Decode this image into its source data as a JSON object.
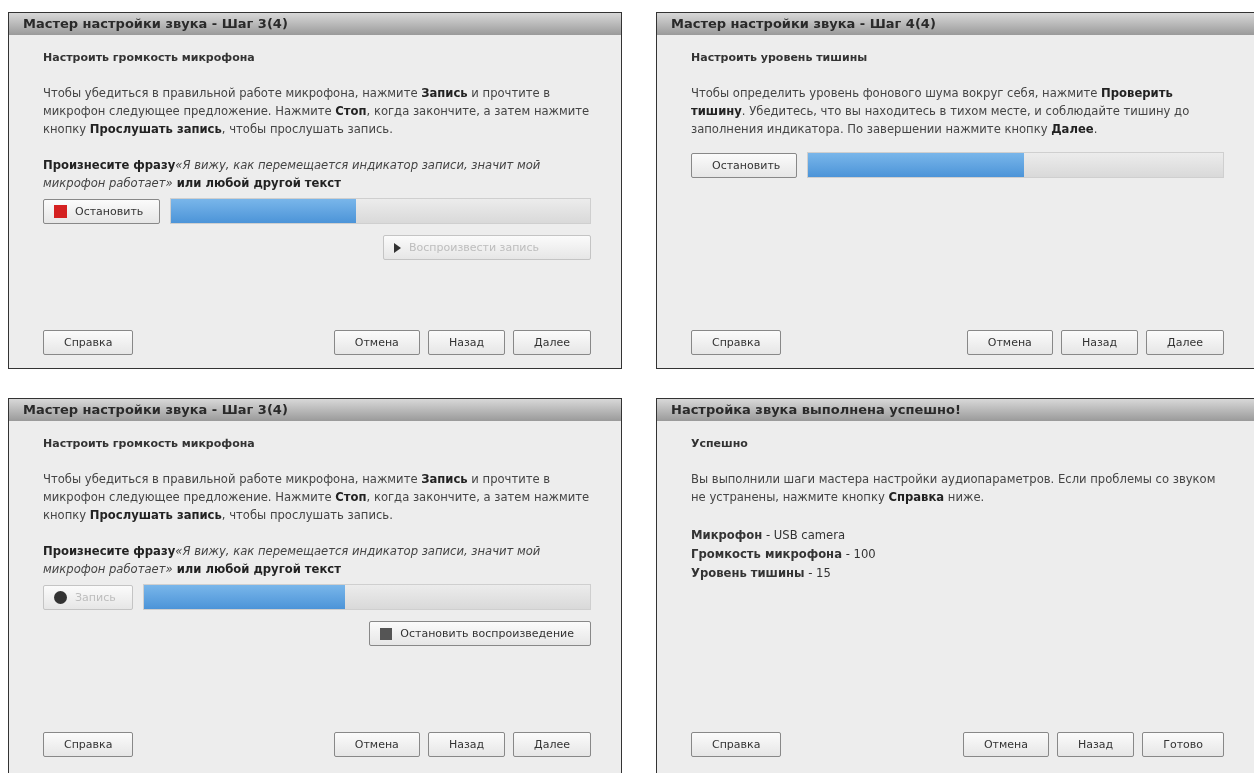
{
  "windows": [
    {
      "title": "Мастер настройки звука - Шаг 3(4)",
      "heading": "Настроить громкость микрофона",
      "paragraphs": [
        "Чтобы убедиться в правильной работе микрофона, нажмите **Запись** и прочтите в микрофон следующее предложение. Нажмите **Стоп**, когда закончите, а затем нажмите кнопку **Прослушать запись**, чтобы прослушать запись."
      ],
      "phrase": {
        "lead": "Произнесите фразу",
        "quote": "«Я вижу, как перемещается индикатор записи, значит мой микрофон работает»",
        "tail": " или любой другой текст"
      },
      "action": {
        "label": "Остановить",
        "kind": "stop",
        "disabled": false
      },
      "level": 0.44,
      "secondary": {
        "label": "Воспроизвести запись",
        "kind": "play",
        "disabled": true
      },
      "buttons": [
        "Справка",
        "Отмена",
        "Назад",
        "Далее"
      ]
    },
    {
      "title": "Мастер настройки звука - Шаг 4(4)",
      "heading": "Настроить уровень тишины",
      "paragraphs": [
        "Чтобы определить уровень фонового шума вокруг себя, нажмите **Проверить тишину**. Убедитесь, что вы находитесь в тихом месте, и соблюдайте тишину до заполнения индикатора. По завершении нажмите кнопку **Далее**."
      ],
      "action": {
        "label": "Остановить",
        "kind": "plain",
        "disabled": false
      },
      "level": 0.52,
      "buttons": [
        "Справка",
        "Отмена",
        "Назад",
        "Далее"
      ]
    },
    {
      "title": "Мастер настройки звука - Шаг 3(4)",
      "heading": "Настроить громкость микрофона",
      "paragraphs": [
        "Чтобы убедиться в правильной работе микрофона, нажмите **Запись** и прочтите в микрофон следующее предложение. Нажмите **Стоп**, когда закончите, а затем нажмите кнопку **Прослушать запись**, чтобы прослушать запись."
      ],
      "phrase": {
        "lead": "Произнесите фразу",
        "quote": "«Я вижу, как перемещается индикатор записи, значит мой микрофон работает»",
        "tail": " или любой другой текст"
      },
      "action": {
        "label": "Запись",
        "kind": "record",
        "disabled": true
      },
      "level": 0.45,
      "secondary": {
        "label": "Остановить воспроизведение",
        "kind": "stop_playback",
        "disabled": false
      },
      "buttons": [
        "Справка",
        "Отмена",
        "Назад",
        "Далее"
      ]
    },
    {
      "title": "Настройка звука выполнена успешно!",
      "heading": "Успешно",
      "paragraphs": [
        "Вы выполнили шаги мастера настройки аудиопараметров. Если проблемы со звуком не устранены, нажмите кнопку **Справка** ниже."
      ],
      "summary": [
        "**Микрофон** - USB camera",
        "**Громкость микрофона** - 100",
        "**Уровень тишины** - 15"
      ],
      "buttons": [
        "Справка",
        "Отмена",
        "Назад",
        "Готово"
      ]
    }
  ]
}
